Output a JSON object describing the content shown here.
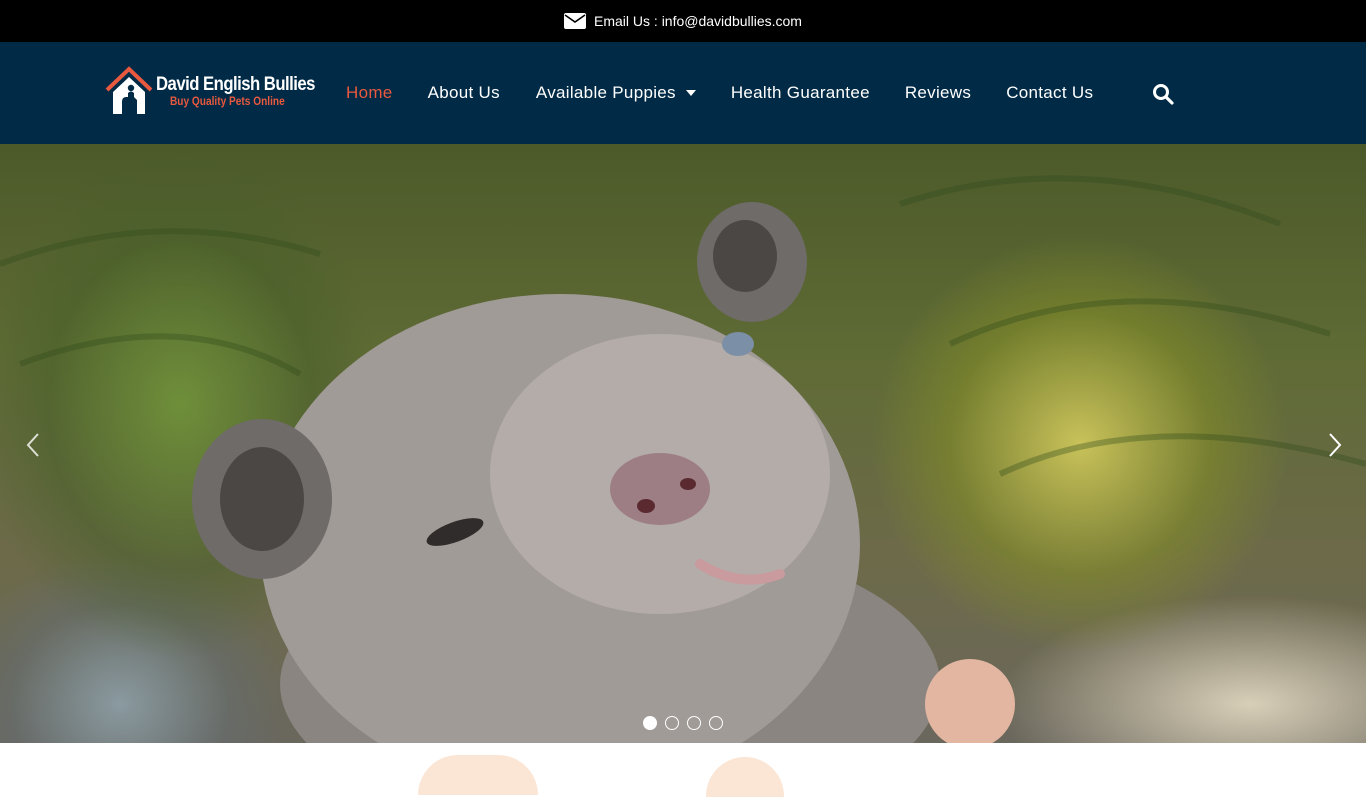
{
  "topbar": {
    "email_text": "Email Us : info@davidbullies.com",
    "icon": "envelope-icon"
  },
  "header": {
    "logo": {
      "brand": "David English Bullies",
      "tagline": "Buy Quality Pets Online",
      "icon": "house-logo-icon"
    },
    "nav": [
      {
        "label": "Home",
        "active": true
      },
      {
        "label": "About Us",
        "active": false
      },
      {
        "label": "Available Puppies",
        "active": false,
        "has_dropdown": true
      },
      {
        "label": "Health Guarantee",
        "active": false
      },
      {
        "label": "Reviews",
        "active": false
      },
      {
        "label": "Contact Us",
        "active": false
      }
    ],
    "search_icon": "search-icon"
  },
  "hero": {
    "image": "french-bulldog-puppy-photo",
    "prev_icon": "chevron-left-icon",
    "next_icon": "chevron-right-icon",
    "slide_count": 4,
    "active_slide": 1
  },
  "colors": {
    "topbar_bg": "#000000",
    "header_bg": "#002a45",
    "accent": "#e8593f",
    "nav_text": "#ffffff"
  }
}
